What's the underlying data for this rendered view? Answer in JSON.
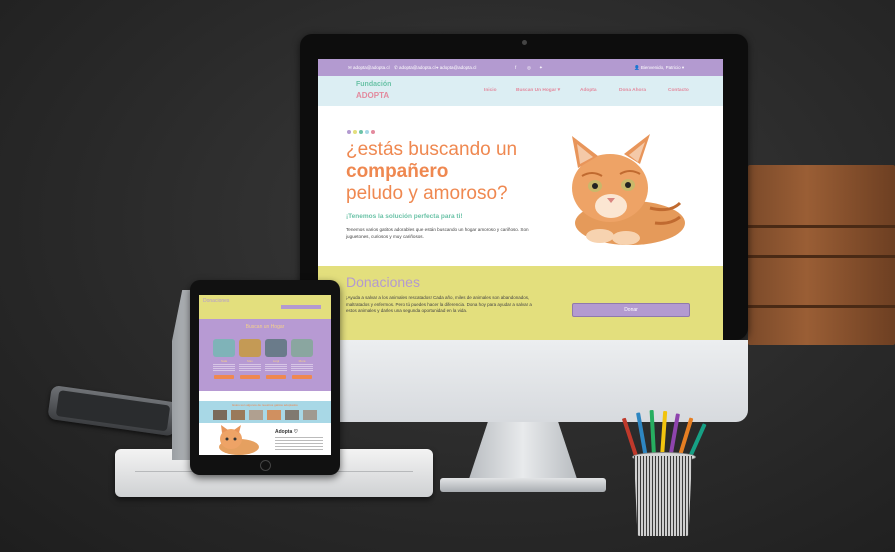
{
  "site": {
    "topbar": {
      "email_1": "adopta@adopta.cl",
      "email_2": "adopta@adopta.cl",
      "email_3": "adopta@adopta.cl",
      "user_greeting": "Bienvenido, Patricio"
    },
    "brand": {
      "line1": "Fundación",
      "line2": "ADOPTA"
    },
    "nav": {
      "inicio": "Inicio",
      "buscan_hogar": "Buscan Un Hogar",
      "adopta": "Adopta",
      "dona": "Dona Ahora",
      "contacto": "Contacto"
    },
    "hero": {
      "line1": "¿estás buscando un",
      "line2": "compañero",
      "line3": "peludo y amoroso?",
      "subtitle": "¡Tenemos la solución perfecta para ti!",
      "paragraph": "Tenemos varios gatitos adorables que están buscando un hogar amoroso y cariñoso. Son juguetones, curiosos y muy cariñosos."
    },
    "donaciones": {
      "title": "Donaciones",
      "paragraph": "¡Ayuda a salvar a los animales rescatados! Cada año, miles de animales son abandonados, maltratados y enfermos. Pero tú puedes hacer la diferencia. Dona hoy para ayudar a salvar a estos animales y darles una segunda oportunidad en la vida.",
      "button": "Donar"
    }
  },
  "tablet": {
    "donaciones": "Donaciones",
    "section_title": "Buscan un Hogar",
    "pets": [
      "Nala",
      "Max",
      "Luigi",
      "Mora"
    ],
    "strip_title": "Estos son algunos de nuestros gatitos adoptados",
    "adopta_title": "Adopta ♡"
  },
  "colors": {
    "lavender": "#b39ad0",
    "mint": "#6cc3a8",
    "pink": "#e38a9e",
    "orange": "#ef8850",
    "yellow": "#e3df7d"
  }
}
